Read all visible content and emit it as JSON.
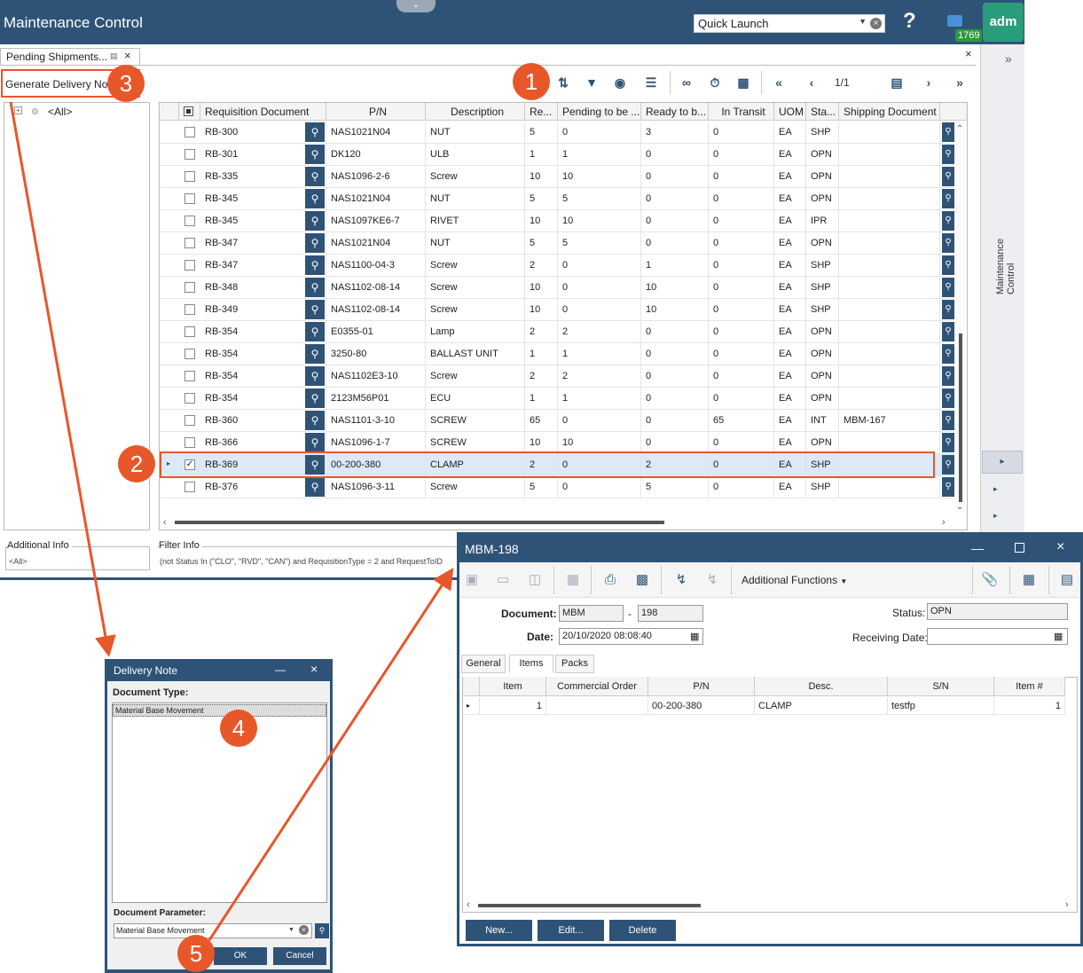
{
  "app": {
    "title": "Maintenance Control",
    "quick_launch": "Quick Launch",
    "notification_count": "1769",
    "avatar_text": "adm",
    "side_panel_label": "Maintenance Control"
  },
  "tab": {
    "label": "Pending Shipments..."
  },
  "toolbar": {
    "generate_delivery_note": "Generate Delivery Note",
    "pager": "1/1"
  },
  "tree": {
    "root": "<All>"
  },
  "grid": {
    "columns": [
      "Requisition Document",
      "P/N",
      "Description",
      "Re...",
      "Pending to be ...",
      "Ready to b...",
      "In Transit",
      "UOM",
      "Sta...",
      "Shipping Document"
    ],
    "rows": [
      {
        "req": "RB-300",
        "pn": "NAS1021N04",
        "desc": "NUT",
        "re": "5",
        "pend": "0",
        "ready": "3",
        "transit": "0",
        "uom": "EA",
        "status": "SHP",
        "ship": "",
        "checked": false
      },
      {
        "req": "RB-301",
        "pn": "DK120",
        "desc": "ULB",
        "re": "1",
        "pend": "1",
        "ready": "0",
        "transit": "0",
        "uom": "EA",
        "status": "OPN",
        "ship": "",
        "checked": false
      },
      {
        "req": "RB-335",
        "pn": "NAS1096-2-6",
        "desc": "Screw",
        "re": "10",
        "pend": "10",
        "ready": "0",
        "transit": "0",
        "uom": "EA",
        "status": "OPN",
        "ship": "",
        "checked": false
      },
      {
        "req": "RB-345",
        "pn": "NAS1021N04",
        "desc": "NUT",
        "re": "5",
        "pend": "5",
        "ready": "0",
        "transit": "0",
        "uom": "EA",
        "status": "OPN",
        "ship": "",
        "checked": false
      },
      {
        "req": "RB-345",
        "pn": "NAS1097KE6-7",
        "desc": "RIVET",
        "re": "10",
        "pend": "10",
        "ready": "0",
        "transit": "0",
        "uom": "EA",
        "status": "IPR",
        "ship": "",
        "checked": false
      },
      {
        "req": "RB-347",
        "pn": "NAS1021N04",
        "desc": "NUT",
        "re": "5",
        "pend": "5",
        "ready": "0",
        "transit": "0",
        "uom": "EA",
        "status": "OPN",
        "ship": "",
        "checked": false
      },
      {
        "req": "RB-347",
        "pn": "NAS1100-04-3",
        "desc": "Screw",
        "re": "2",
        "pend": "0",
        "ready": "1",
        "transit": "0",
        "uom": "EA",
        "status": "SHP",
        "ship": "",
        "checked": false
      },
      {
        "req": "RB-348",
        "pn": "NAS1102-08-14",
        "desc": "Screw",
        "re": "10",
        "pend": "0",
        "ready": "10",
        "transit": "0",
        "uom": "EA",
        "status": "SHP",
        "ship": "",
        "checked": false
      },
      {
        "req": "RB-349",
        "pn": "NAS1102-08-14",
        "desc": "Screw",
        "re": "10",
        "pend": "0",
        "ready": "10",
        "transit": "0",
        "uom": "EA",
        "status": "SHP",
        "ship": "",
        "checked": false
      },
      {
        "req": "RB-354",
        "pn": "E0355-01",
        "desc": "Lamp",
        "re": "2",
        "pend": "2",
        "ready": "0",
        "transit": "0",
        "uom": "EA",
        "status": "OPN",
        "ship": "",
        "checked": false
      },
      {
        "req": "RB-354",
        "pn": "3250-80",
        "desc": "BALLAST UNIT",
        "re": "1",
        "pend": "1",
        "ready": "0",
        "transit": "0",
        "uom": "EA",
        "status": "OPN",
        "ship": "",
        "checked": false
      },
      {
        "req": "RB-354",
        "pn": "NAS1102E3-10",
        "desc": "Screw",
        "re": "2",
        "pend": "2",
        "ready": "0",
        "transit": "0",
        "uom": "EA",
        "status": "OPN",
        "ship": "",
        "checked": false
      },
      {
        "req": "RB-354",
        "pn": "2123M56P01",
        "desc": "ECU",
        "re": "1",
        "pend": "1",
        "ready": "0",
        "transit": "0",
        "uom": "EA",
        "status": "OPN",
        "ship": "",
        "checked": false
      },
      {
        "req": "RB-360",
        "pn": "NAS1101-3-10",
        "desc": "SCREW",
        "re": "65",
        "pend": "0",
        "ready": "0",
        "transit": "65",
        "uom": "EA",
        "status": "INT",
        "ship": "MBM-167",
        "checked": false
      },
      {
        "req": "RB-366",
        "pn": "NAS1096-1-7",
        "desc": "SCREW",
        "re": "10",
        "pend": "10",
        "ready": "0",
        "transit": "0",
        "uom": "EA",
        "status": "OPN",
        "ship": "",
        "checked": false
      },
      {
        "req": "RB-369",
        "pn": "00-200-380",
        "desc": "CLAMP",
        "re": "2",
        "pend": "0",
        "ready": "2",
        "transit": "0",
        "uom": "EA",
        "status": "SHP",
        "ship": "",
        "checked": true
      },
      {
        "req": "RB-376",
        "pn": "NAS1096-3-11",
        "desc": "Screw",
        "re": "5",
        "pend": "0",
        "ready": "5",
        "transit": "0",
        "uom": "EA",
        "status": "SHP",
        "ship": "",
        "checked": false
      }
    ]
  },
  "info": {
    "additional_label": "Additional Info",
    "additional_value": "<All>",
    "filter_label": "Filter Info",
    "filter_value": "(not Status In (\"CLO\", \"RVD\", \"CAN\") and RequisitionType = 2 and RequestToID"
  },
  "delivery_dialog": {
    "title": "Delivery Note",
    "doc_type_label": "Document Type:",
    "doc_type_item": "Material Base Movement",
    "param_label": "Document Parameter:",
    "param_value": "Material Base Movement",
    "ok": "OK",
    "cancel": "Cancel"
  },
  "mbm": {
    "title": "MBM-198",
    "additional_functions": "Additional Functions",
    "document_label": "Document:",
    "doc_prefix": "MBM",
    "doc_number": "198",
    "date_label": "Date:",
    "date_value": "20/10/2020 08:08:40",
    "status_label": "Status:",
    "status_value": "OPN",
    "receiving_label": "Receiving Date:",
    "tabs": [
      "General",
      "Items",
      "Packs"
    ],
    "columns": [
      "Item",
      "Commercial Order",
      "P/N",
      "Desc.",
      "S/N",
      "Item #"
    ],
    "row": {
      "item": "1",
      "order": "",
      "pn": "00-200-380",
      "desc": "CLAMP",
      "sn": "testfp",
      "itemno": "1"
    },
    "buttons": {
      "new": "New...",
      "edit": "Edit...",
      "delete": "Delete"
    }
  },
  "badges": [
    "1",
    "2",
    "3",
    "4",
    "5"
  ],
  "colors": {
    "primary": "#2e5377",
    "accent": "#e8572a",
    "badge_green": "#2c9b3c"
  }
}
